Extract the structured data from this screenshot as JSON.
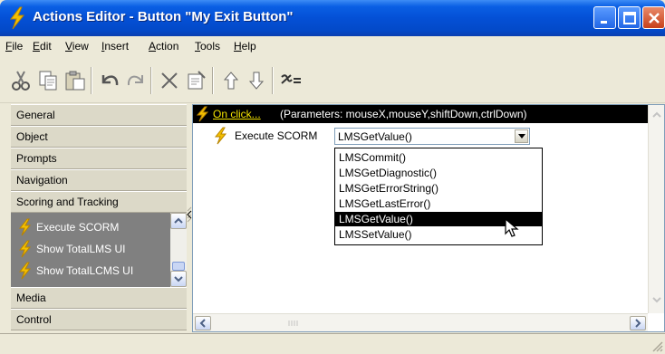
{
  "window": {
    "title": "Actions Editor - Button \"My Exit Button\""
  },
  "menu": {
    "items": [
      {
        "key": "F",
        "rest": "ile"
      },
      {
        "key": "E",
        "rest": "dit"
      },
      {
        "key": "V",
        "rest": "iew"
      },
      {
        "key": "I",
        "rest": "nsert"
      },
      {
        "key": "A",
        "rest": "ction"
      },
      {
        "key": "T",
        "rest": "ools"
      },
      {
        "key": "H",
        "rest": "elp"
      }
    ]
  },
  "toolbar": {
    "icons": [
      "cut-icon",
      "copy-icon",
      "paste-icon",
      "undo-icon",
      "redo-icon",
      "delete-icon",
      "properties-icon",
      "move-up-icon",
      "move-down-icon",
      "variables-icon"
    ]
  },
  "categories": {
    "general": "General",
    "object": "Object",
    "prompts": "Prompts",
    "navigation": "Navigation",
    "scoring": "Scoring and Tracking",
    "media": "Media",
    "control": "Control"
  },
  "subitems": [
    "Execute SCORM",
    "Show TotalLMS UI",
    "Show TotalLCMS UI"
  ],
  "event": {
    "trigger": "On click...",
    "params": "(Parameters: mouseX,mouseY,shiftDown,ctrlDown)"
  },
  "action": {
    "label": "Execute SCORM",
    "selected": "LMSGetValue()",
    "options": [
      "LMSCommit()",
      "LMSGetDiagnostic()",
      "LMSGetErrorString()",
      "LMSGetLastError()",
      "LMSGetValue()",
      "LMSSetValue()"
    ],
    "highlighted_index": 4
  },
  "colors": {
    "titlebar": "#0450d6",
    "bolt": "#f4c000",
    "highlight": "#000000",
    "trigger_text": "#f4e300"
  }
}
